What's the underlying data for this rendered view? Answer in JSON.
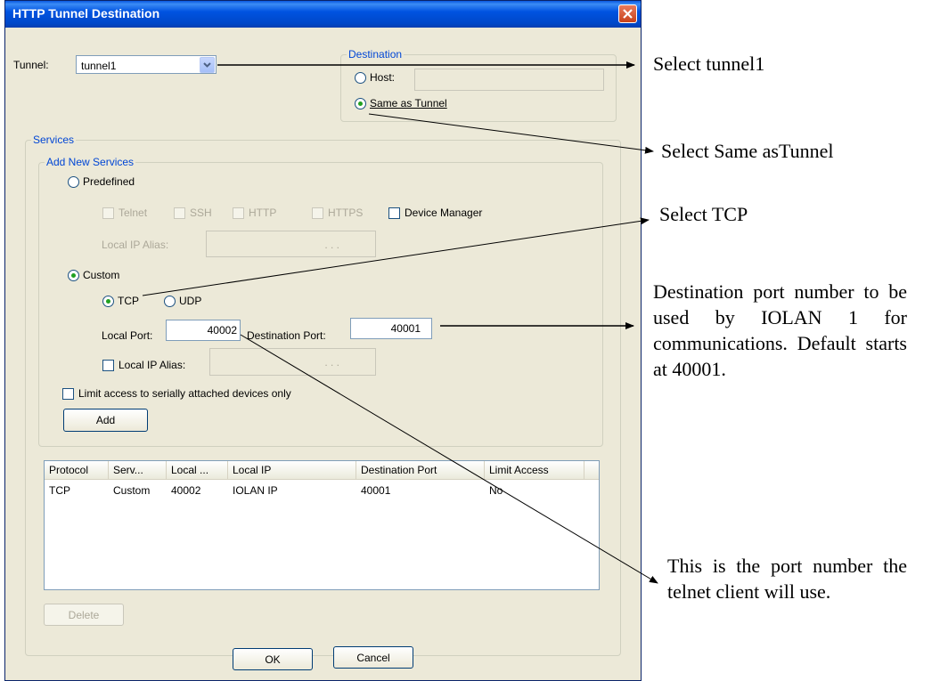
{
  "window": {
    "title": "HTTP Tunnel Destination"
  },
  "tunnel": {
    "label": "Tunnel:",
    "value": "tunnel1"
  },
  "destination": {
    "legend": "Destination",
    "host_label": "Host:",
    "host_value": "",
    "same_as_tunnel_label": "Same as Tunnel",
    "selected": "same_as_tunnel"
  },
  "services": {
    "legend": "Services",
    "add_new": {
      "legend": "Add New Services",
      "predefined_label": "Predefined",
      "predefined_options": {
        "telnet": "Telnet",
        "ssh": "SSH",
        "http": "HTTP",
        "https": "HTTPS",
        "device_manager": "Device Manager"
      },
      "predefined_local_ip_alias_label": "Local IP Alias:",
      "ip_placeholder_dots": ".      .      .",
      "custom_label": "Custom",
      "tcp_label": "TCP",
      "udp_label": "UDP",
      "local_port_label": "Local Port:",
      "local_port_value": "40002",
      "destination_port_label": "Destination Port:",
      "destination_port_value": "40001",
      "custom_local_ip_alias_label": "Local IP Alias:",
      "limit_access_label": "Limit access to serially attached devices only",
      "add_button": "Add"
    },
    "table": {
      "columns": [
        "Protocol",
        "Serv...",
        "Local ...",
        "Local IP",
        "Destination Port",
        "Limit Access"
      ],
      "rows": [
        [
          "TCP",
          "Custom",
          "40002",
          "IOLAN IP",
          "40001",
          "No"
        ]
      ]
    },
    "delete_button": "Delete"
  },
  "footer": {
    "ok_button": "OK",
    "cancel_button": "Cancel"
  },
  "annotations": {
    "select_tunnel": "Select tunnel1",
    "select_same": "Select Same asTunnel",
    "select_tcp": "Select TCP",
    "destination_port_note": "Destination port number to be used by IOLAN 1 for communications. Default starts at 40001.",
    "local_port_note": "This is the port number the telnet client will use."
  },
  "colors": {
    "title_bar": "#0054e3",
    "dialog_bg": "#ece9d8",
    "legend_text": "#0046d5"
  }
}
